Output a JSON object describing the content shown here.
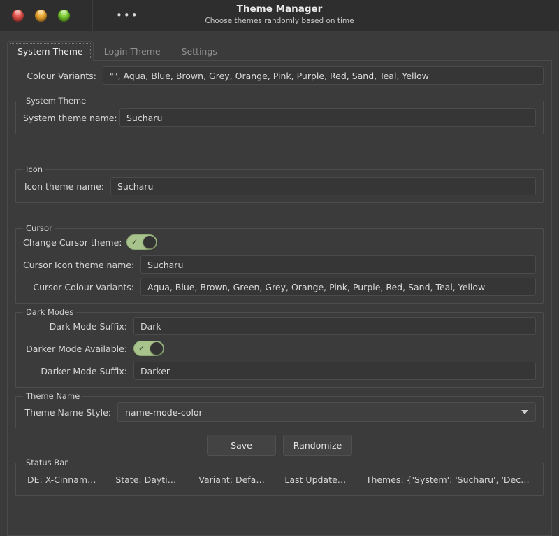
{
  "titlebar": {
    "window_buttons": [
      "close-button",
      "minimize-button",
      "maximize-button"
    ],
    "menu_label": "•••",
    "title": "Theme Manager",
    "subtitle": "Choose themes randomly based on time"
  },
  "tabs": [
    {
      "label": "System Theme",
      "active": true
    },
    {
      "label": "Login Theme",
      "active": false
    },
    {
      "label": "Settings",
      "active": false
    }
  ],
  "colour_variants": {
    "label": "Colour Variants:",
    "value": "\"\", Aqua, Blue, Brown, Grey, Orange, Pink, Purple, Red, Sand, Teal, Yellow"
  },
  "system_theme": {
    "legend": "System Theme",
    "name_label": "System theme name:",
    "name_value": "Sucharu"
  },
  "icon": {
    "legend": "Icon",
    "name_label": "Icon theme name:",
    "name_value": "Sucharu"
  },
  "cursor": {
    "legend": "Cursor",
    "change_label": "Change Cursor theme:",
    "change_enabled": true,
    "icon_name_label": "Cursor Icon theme name:",
    "icon_name_value": "Sucharu",
    "variants_label": "Cursor Colour Variants:",
    "variants_value": "Aqua, Blue, Brown, Green, Grey, Orange, Pink, Purple, Red, Sand, Teal, Yellow"
  },
  "dark_modes": {
    "legend": "Dark Modes",
    "dark_suffix_label": "Dark Mode Suffix:",
    "dark_suffix_value": "Dark",
    "darker_available_label": "Darker Mode Available:",
    "darker_available_enabled": true,
    "darker_suffix_label": "Darker Mode Suffix:",
    "darker_suffix_value": "Darker"
  },
  "theme_name": {
    "legend": "Theme Name",
    "style_label": "Theme Name Style:",
    "style_value": "name-mode-color"
  },
  "actions": {
    "save_label": "Save",
    "randomize_label": "Randomize"
  },
  "status_bar": {
    "legend": "Status Bar",
    "items": [
      "DE: X-Cinnamon,",
      "State: Daytime,",
      "Variant: Default,",
      "Last Updated: ,",
      "Themes: {'System': 'Sucharu', 'Decor..."
    ]
  },
  "colors": {
    "window_bg": "#3b3b3b",
    "titlebar_bg": "#2e2e2e",
    "toggle_on": "#a9c38d",
    "close_button": "#e0514a",
    "minimize_button": "#e8a531",
    "maximize_button": "#77c930"
  }
}
